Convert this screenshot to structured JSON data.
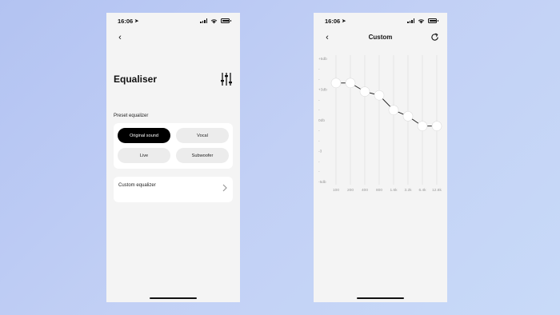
{
  "left_screen": {
    "status": {
      "time": "16:06"
    },
    "title": "Equaliser",
    "preset_section_label": "Preset equalizer",
    "presets": [
      {
        "label": "Original sound",
        "active": true
      },
      {
        "label": "Vocal",
        "active": false
      },
      {
        "label": "Live",
        "active": false
      },
      {
        "label": "Subwoofer",
        "active": false
      }
    ],
    "custom_equalizer_label": "Custom equalizer"
  },
  "right_screen": {
    "status": {
      "time": "16:06"
    },
    "title": "Custom",
    "y_labels": [
      "+5db",
      "-",
      "-",
      "+3db",
      "-",
      "-",
      "0db",
      "-",
      "-",
      "-3",
      "-",
      "-",
      "-5db"
    ],
    "freq_labels": [
      "100",
      "200",
      "400",
      "800",
      "1.6k",
      "3.2k",
      "6.4k",
      "12.8k"
    ],
    "gains_db": [
      3,
      3,
      2.3,
      2,
      0.8,
      0.3,
      -0.5,
      -0.5
    ],
    "gain_range_db": [
      -5,
      5
    ]
  },
  "colors": {
    "background": "#bccaf4",
    "screen": "#f4f4f4",
    "card": "#ffffff",
    "accent": "#000000",
    "grid": "#e2e2e2"
  },
  "icons": {
    "back": "chevron-left-icon",
    "location": "location-arrow-icon",
    "sliders": "sliders-vertical-icon",
    "chevron": "chevron-right-icon",
    "refresh": "refresh-icon"
  }
}
